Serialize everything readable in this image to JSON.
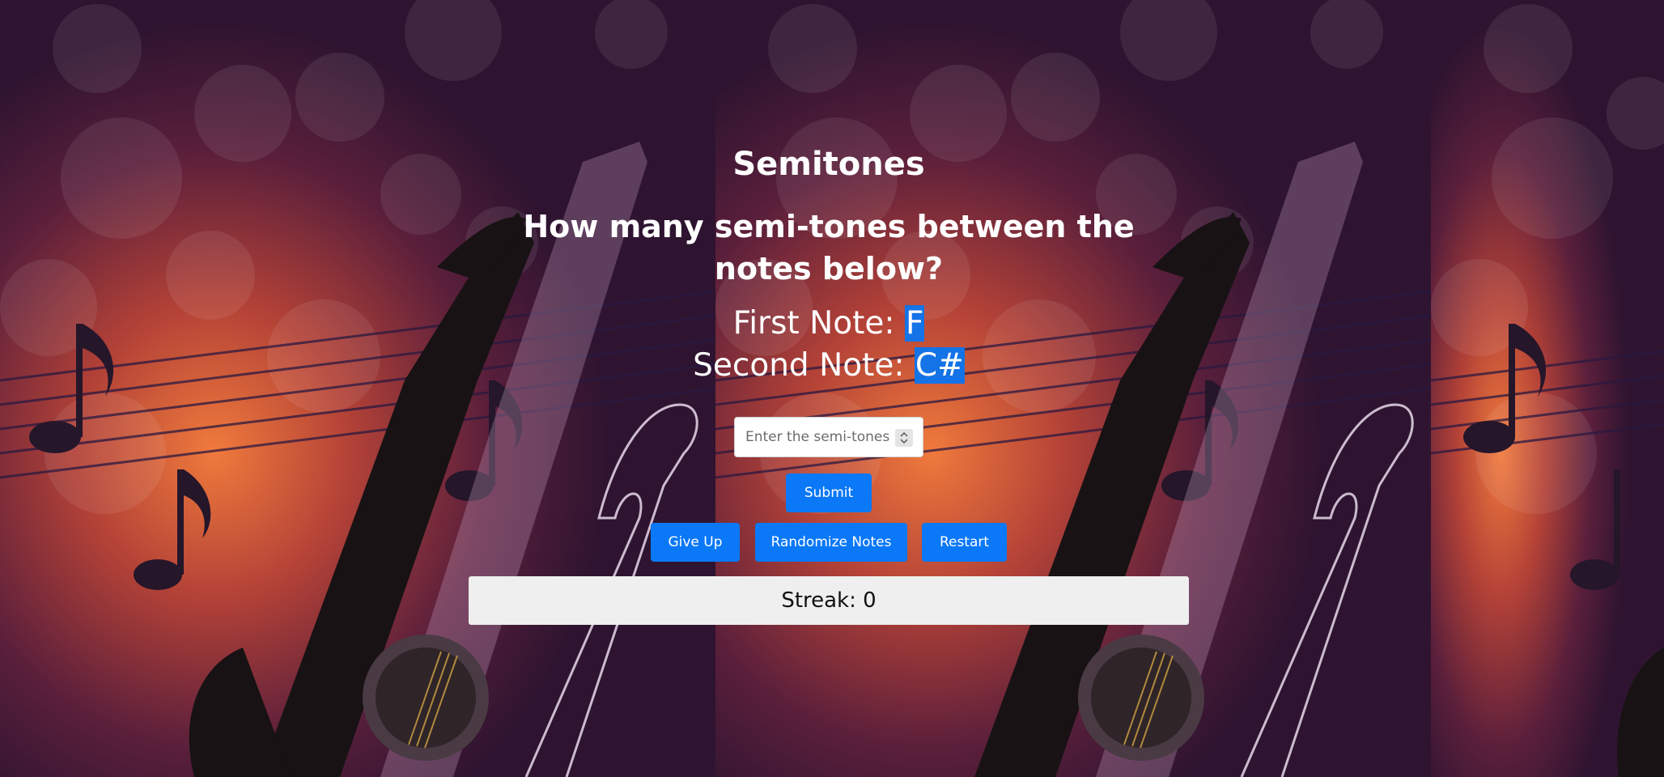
{
  "app": {
    "title": "Semitones",
    "question": "How many semi-tones between the notes below?"
  },
  "notes": {
    "first_label": "First Note: ",
    "first_value": "F",
    "second_label": "Second Note: ",
    "second_value": "C#"
  },
  "input": {
    "placeholder": "Enter the semi-tones",
    "value": ""
  },
  "buttons": {
    "submit": "Submit",
    "give_up": "Give Up",
    "randomize": "Randomize Notes",
    "restart": "Restart"
  },
  "streak": {
    "label": "Streak: 0"
  },
  "colors": {
    "accent": "#0a78f7",
    "highlight": "#1473e6",
    "background": "#2e1430"
  },
  "icons": {
    "spinner": "number-stepper-icon"
  }
}
